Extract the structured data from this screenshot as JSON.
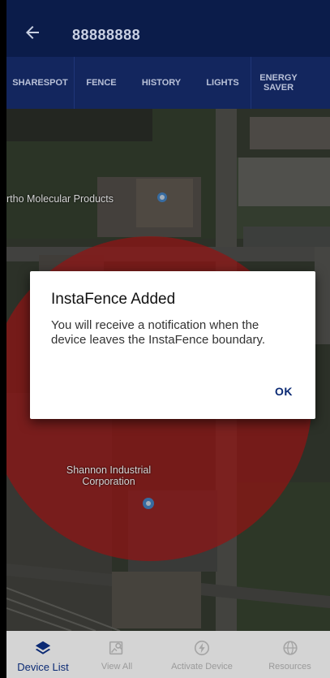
{
  "header": {
    "back_icon": "arrow-left-icon",
    "title": "88888888"
  },
  "tabs": [
    {
      "label": "SHARESPOT"
    },
    {
      "label": "FENCE"
    },
    {
      "label": "HISTORY"
    },
    {
      "label": "LIGHTS"
    },
    {
      "label": "ENERGY SAVER"
    }
  ],
  "map": {
    "labels": {
      "ortho": "rtho Molecular Products",
      "shannon": "Shannon Industrial Corporation"
    },
    "fence_color": "#c21a1a"
  },
  "dialog": {
    "title": "InstaFence Added",
    "body": "You will receive a notification when the device leaves the InstaFence boundary.",
    "ok_label": "OK"
  },
  "bottom_nav": [
    {
      "label": "Device List",
      "icon": "layers-icon",
      "active": true
    },
    {
      "label": "View All",
      "icon": "map-search-icon",
      "active": false
    },
    {
      "label": "Activate Device",
      "icon": "lightning-circle-icon",
      "active": false
    },
    {
      "label": "Resources",
      "icon": "globe-icon",
      "active": false
    }
  ],
  "colors": {
    "appbar": "#0b1c4a",
    "tabs": "#13265e",
    "accent": "#0b2a74",
    "bottom_nav": "#d4d4d4"
  }
}
